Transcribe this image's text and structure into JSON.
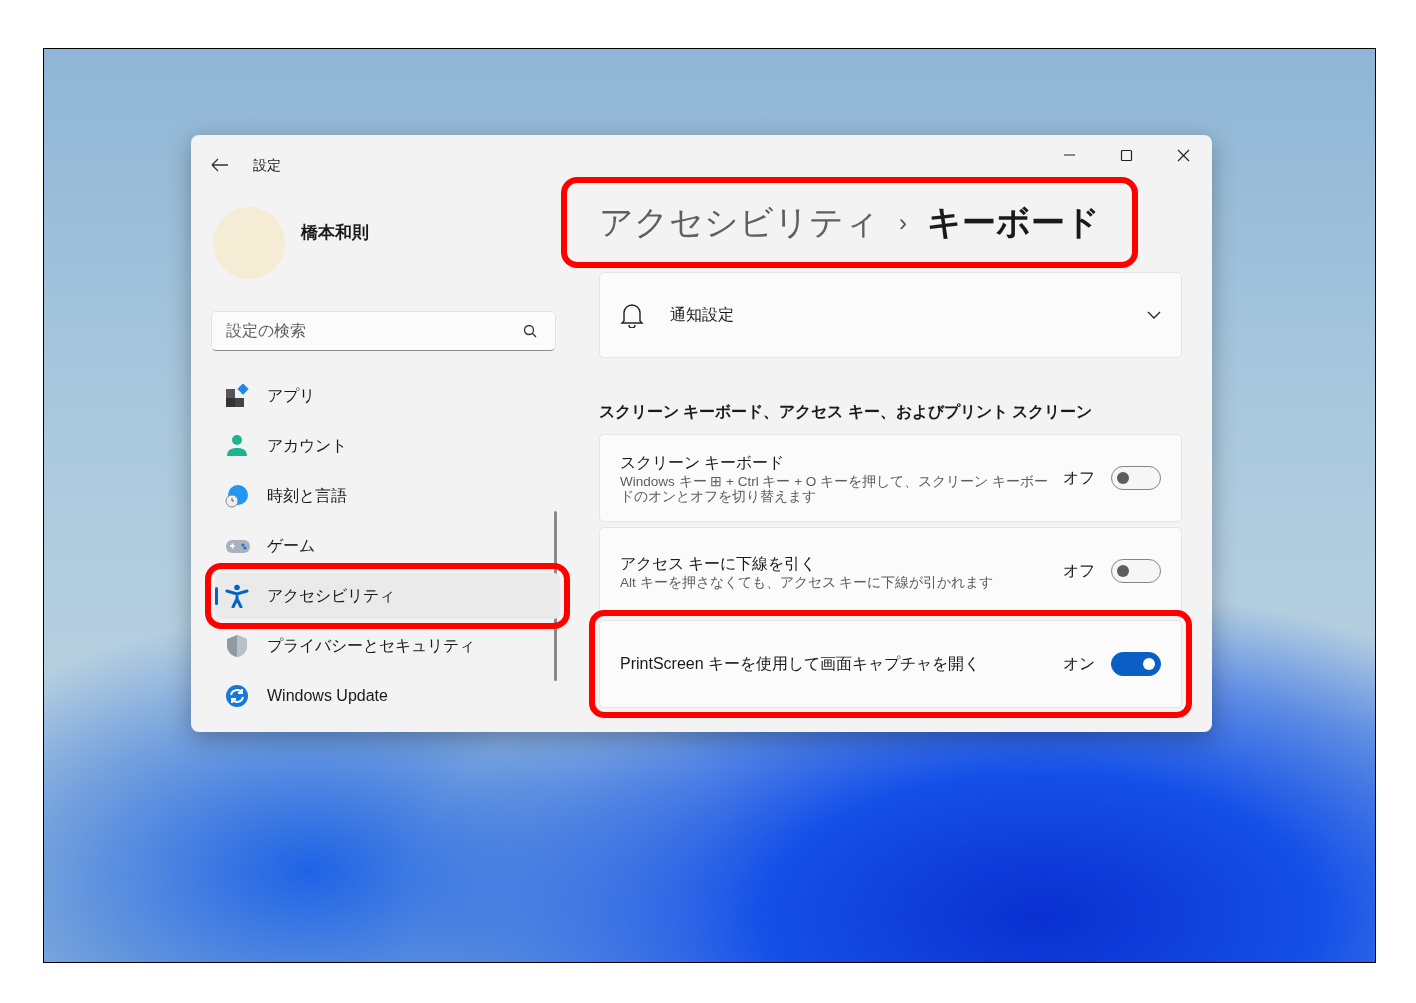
{
  "window": {
    "title": "設定"
  },
  "user": {
    "name": "橋本和則"
  },
  "search": {
    "placeholder": "設定の検索"
  },
  "sidebar": {
    "items": [
      {
        "label": "アプリ",
        "selected": false,
        "highlighted": false
      },
      {
        "label": "アカウント",
        "selected": false,
        "highlighted": false
      },
      {
        "label": "時刻と言語",
        "selected": false,
        "highlighted": false
      },
      {
        "label": "ゲーム",
        "selected": false,
        "highlighted": false
      },
      {
        "label": "アクセシビリティ",
        "selected": true,
        "highlighted": true
      },
      {
        "label": "プライバシーとセキュリティ",
        "selected": false,
        "highlighted": false
      },
      {
        "label": "Windows Update",
        "selected": false,
        "highlighted": false
      }
    ]
  },
  "breadcrumb": {
    "parent": "アクセシビリティ",
    "separator": "›",
    "current": "キーボード",
    "highlighted": true
  },
  "notification": {
    "label": "通知設定",
    "expanded": false
  },
  "section_title": "スクリーン キーボード、アクセス キー、およびプリント スクリーン",
  "settings": [
    {
      "title": "スクリーン キーボード",
      "description": "Windows キー ⊞ + Ctrl キー + O キーを押して、スクリーン キーボードのオンとオフを切り替えます",
      "state_label": "オフ",
      "on": false,
      "highlighted": false
    },
    {
      "title": "アクセス キーに下線を引く",
      "description": "Alt キーを押さなくても、アクセス キーに下線が引かれます",
      "state_label": "オフ",
      "on": false,
      "highlighted": false
    },
    {
      "title": "PrintScreen キーを使用して画面キャプチャを開く",
      "state_label": "オン",
      "on": true,
      "highlighted": true
    }
  ]
}
